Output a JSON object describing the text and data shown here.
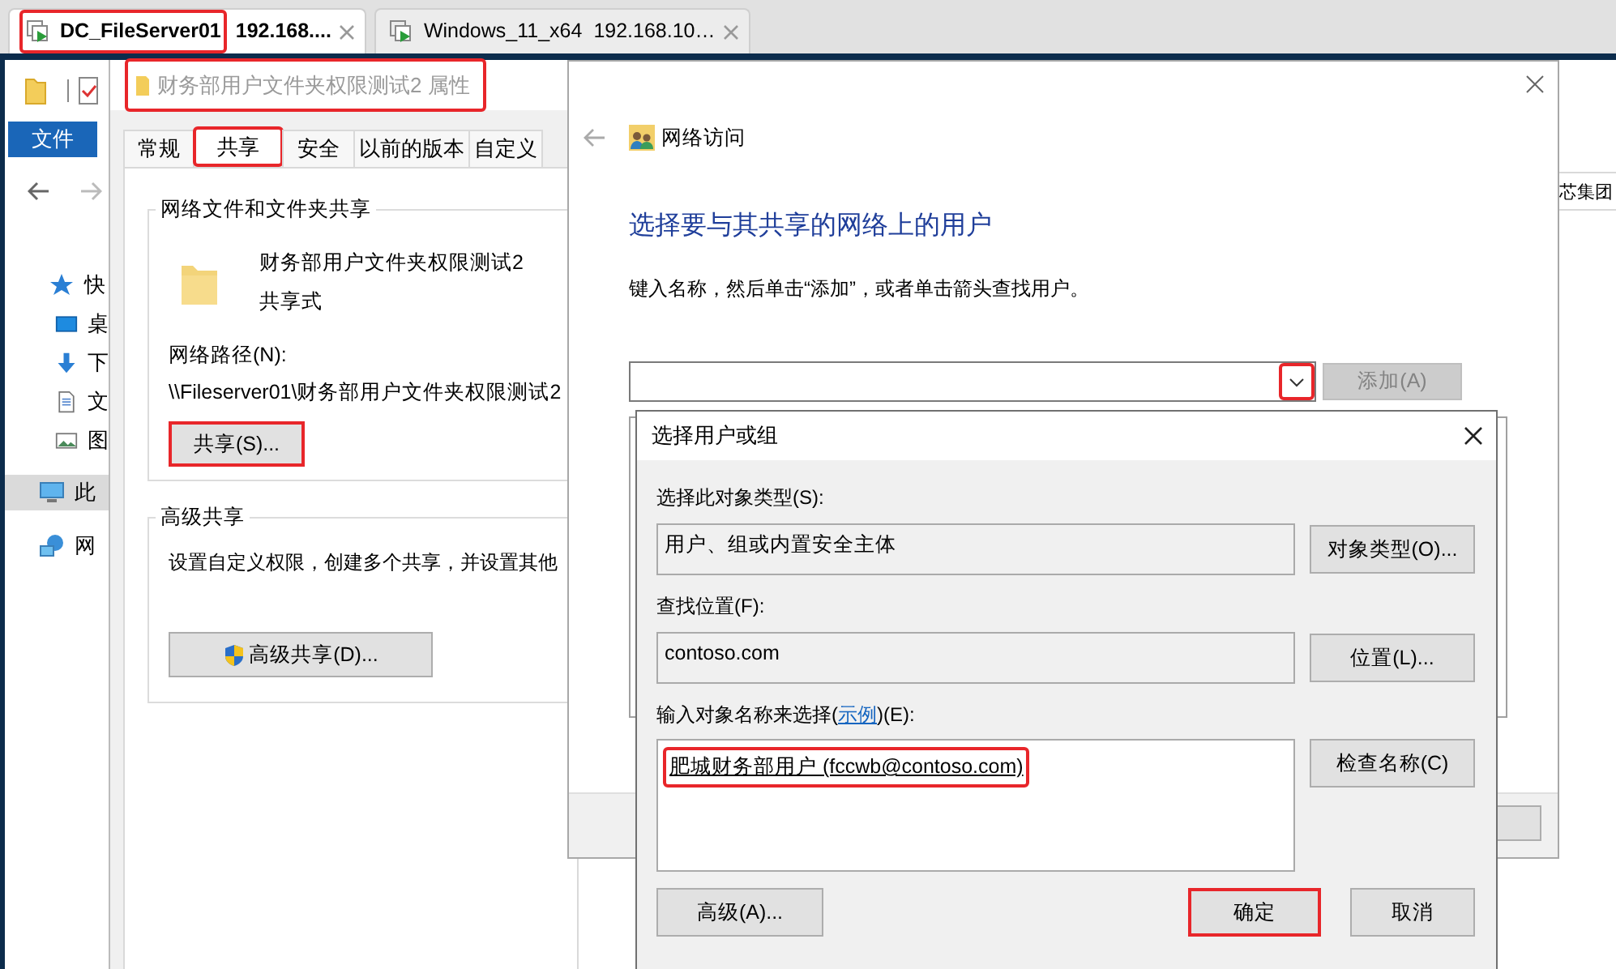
{
  "browser_tabs": [
    {
      "name": "DC_FileServer01",
      "address": "192.168....",
      "selected": true,
      "highlighted": true
    },
    {
      "name": "Windows_11_x64",
      "address": "192.168.10…",
      "selected": false,
      "highlighted": false
    }
  ],
  "explorer": {
    "ribbon_tab": "文件",
    "address_fragment": "芯集团",
    "sidebar": [
      {
        "label": "快",
        "kind": "quick",
        "selected": false
      },
      {
        "label": "桌",
        "kind": "desktop",
        "selected": false
      },
      {
        "label": "下",
        "kind": "downloads",
        "selected": false
      },
      {
        "label": "文",
        "kind": "documents",
        "selected": false
      },
      {
        "label": "图",
        "kind": "pictures",
        "selected": false
      },
      {
        "label": "此",
        "kind": "pc",
        "selected": true
      },
      {
        "label": "网",
        "kind": "network",
        "selected": false
      }
    ]
  },
  "properties": {
    "title": "财务部用户文件夹权限测试2 属性",
    "title_highlighted": true,
    "tabs": [
      {
        "label": "常规",
        "selected": false,
        "highlighted": false
      },
      {
        "label": "共享",
        "selected": true,
        "highlighted": true
      },
      {
        "label": "安全",
        "selected": false,
        "highlighted": false
      },
      {
        "label": "以前的版本",
        "selected": false,
        "highlighted": false
      },
      {
        "label": "自定义",
        "selected": false,
        "highlighted": false
      }
    ],
    "share_group": {
      "title": "网络文件和文件夹共享",
      "folder_name": "财务部用户文件夹权限测试2",
      "folder_state": "共享式",
      "path_label": "网络路径(N):",
      "path": "\\\\Fileserver01\\财务部用户文件夹权限测试2",
      "button": {
        "label": "共享(S)...",
        "highlighted": true
      }
    },
    "advanced_group": {
      "title": "高级共享",
      "description": "设置自定义权限，创建多个共享，并设置其他",
      "button": {
        "label": "高级共享(D)..."
      }
    }
  },
  "network_access": {
    "title": "网络访问",
    "heading": "选择要与其共享的网络上的用户",
    "instruction": "键入名称，然后单击“添加”，或者单击箭头查找用户。",
    "dropdown_highlighted": true,
    "add_button": {
      "label": "添加(A)",
      "disabled": true
    }
  },
  "select_dialog": {
    "title": "选择用户或组",
    "object_type_label": "选择此对象类型(S):",
    "object_type": "用户、组或内置安全主体",
    "object_type_button": {
      "label": "对象类型(O)..."
    },
    "location_label": "查找位置(F):",
    "location": "contoso.com",
    "location_button": {
      "label": "位置(L)..."
    },
    "names_label": "输入对象名称来选择(",
    "names_link": "示例",
    "names_label_end": ")(E):",
    "names_value": "肥城财务部用户 (fccwb@contoso.com)",
    "names_highlighted": true,
    "check_button": {
      "label": "检查名称(C)"
    },
    "advanced_button": {
      "label": "高级(A)..."
    },
    "ok_button": {
      "label": "确定",
      "highlighted": true
    },
    "cancel_button": {
      "label": "取消"
    }
  }
}
